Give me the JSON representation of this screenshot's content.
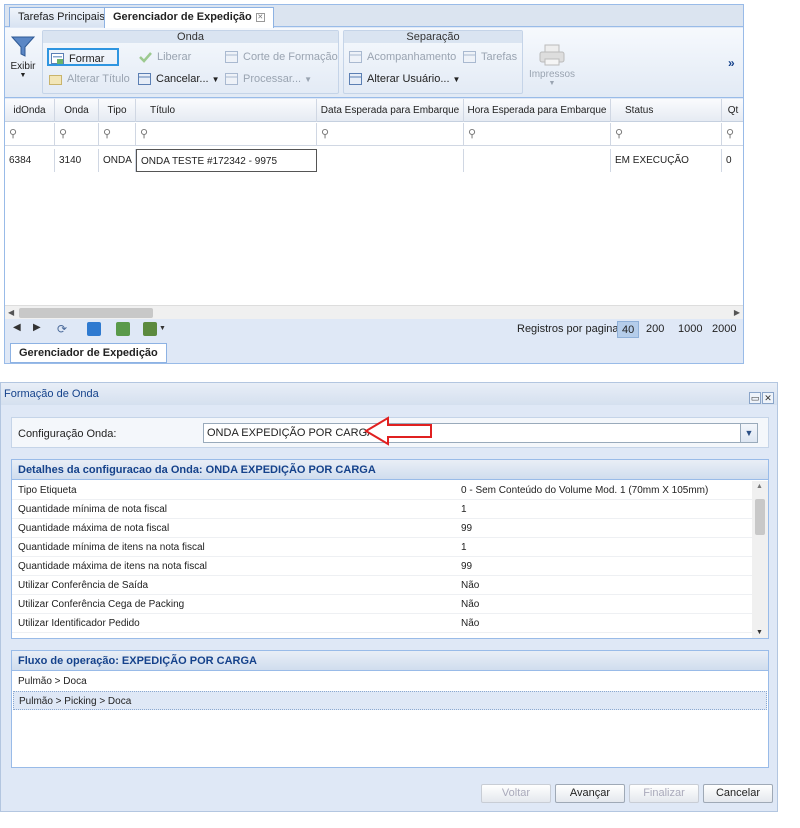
{
  "tabs": {
    "main": "Tarefas Principais",
    "manager": "Gerenciador de Expedição"
  },
  "ribbon": {
    "exibir": "Exibir",
    "onda_title": "Onda",
    "formar": "Formar",
    "liberar": "Liberar",
    "corte": "Corte de Formação",
    "alterar_titulo": "Alterar Título",
    "cancelar": "Cancelar...",
    "processar": "Processar...",
    "separacao_title": "Separação",
    "acompanhamento": "Acompanhamento",
    "tarefas": "Tarefas",
    "alterar_usuario": "Alterar Usuário...",
    "impressos": "Impressos",
    "more": "»"
  },
  "grid": {
    "columns": [
      "idOnda",
      "Onda",
      "Tipo",
      "Título",
      "Data Esperada para Embarque",
      "Hora Esperada para Embarque",
      "Status",
      "Qt"
    ],
    "rows": [
      [
        "6384",
        "3140",
        "ONDA",
        "ONDA TESTE #172342 - 9975",
        "",
        "",
        "EM EXECUÇÃO",
        "0"
      ]
    ]
  },
  "pager": {
    "label": "Registros por pagina:",
    "sizes": [
      "40",
      "200",
      "1000",
      "2000"
    ],
    "selected": "40"
  },
  "bottom_tab": "Gerenciador de Expedição",
  "dialog": {
    "title": "Formação de Onda",
    "config_label": "Configuração Onda:",
    "config_value": "ONDA EXPEDIÇÃO POR CARGA",
    "details_title": "Detalhes da configuracao da Onda: ONDA EXPEDIÇÃO POR CARGA",
    "details": [
      {
        "k": "Tipo Etiqueta",
        "v": "0 - Sem Conteúdo do Volume Mod. 1 (70mm X 105mm)"
      },
      {
        "k": "Quantidade mínima de nota fiscal",
        "v": "1"
      },
      {
        "k": "Quantidade máxima de nota fiscal",
        "v": "99"
      },
      {
        "k": "Quantidade mínima de itens na nota fiscal",
        "v": "1"
      },
      {
        "k": "Quantidade máxima de itens na nota fiscal",
        "v": "99"
      },
      {
        "k": "Utilizar Conferência de Saída",
        "v": "Não"
      },
      {
        "k": "Utilizar Conferência Cega de Packing",
        "v": "Não"
      },
      {
        "k": "Utilizar Identificador Pedido",
        "v": "Não"
      }
    ],
    "flow_title": "Fluxo de operação: EXPEDIÇÃO POR CARGA",
    "flows": [
      "Pulmão > Doca",
      "Pulmão > Picking > Doca"
    ],
    "buttons": {
      "voltar": "Voltar",
      "avancar": "Avançar",
      "finalizar": "Finalizar",
      "cancelar": "Cancelar"
    }
  }
}
